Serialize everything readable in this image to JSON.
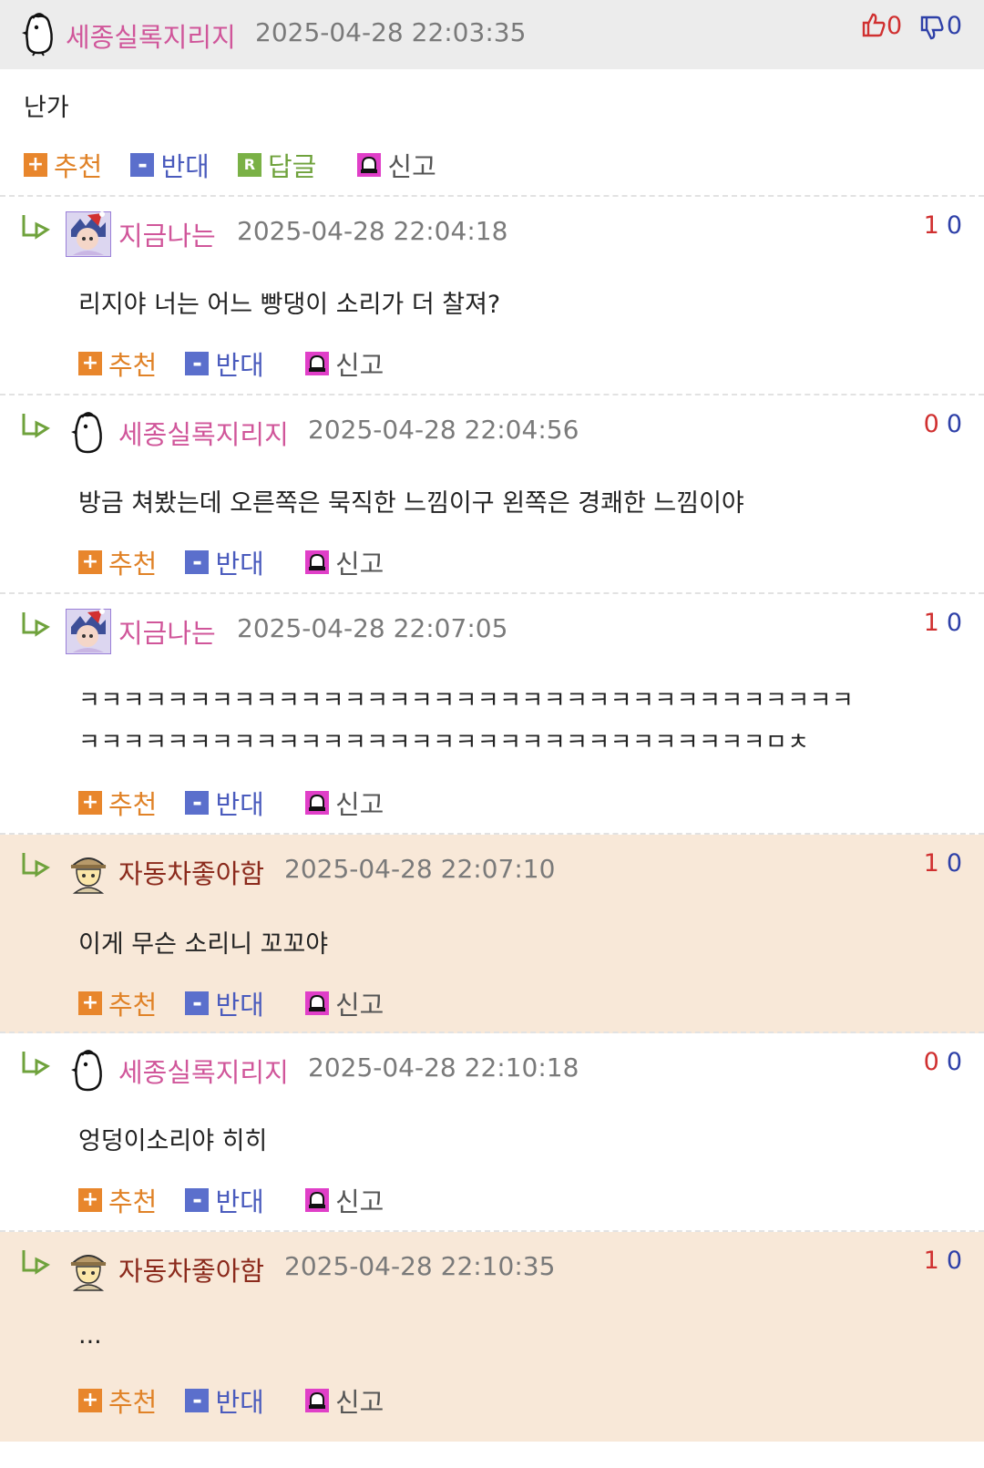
{
  "top": {
    "nick": "세종실록지리지",
    "date": "2025-04-28 22:03:35",
    "up": "0",
    "down": "0",
    "text": "난가",
    "actions": {
      "recommend": "추천",
      "oppose": "반대",
      "reply": "답글",
      "report": "신고"
    }
  },
  "replies": [
    {
      "nick": "지금나는",
      "date": "2025-04-28 22:04:18",
      "up": "1",
      "down": "0",
      "line1": "리지야 너는 어느 빵댕이 소리가 더 찰져?",
      "line2": ""
    },
    {
      "nick": "세종실록지리지",
      "date": "2025-04-28 22:04:56",
      "up": "0",
      "down": "0",
      "line1": "방금 쳐봤는데 오른쪽은 묵직한 느낌이구 왼쪽은 경쾌한 느낌이야",
      "line2": ""
    },
    {
      "nick": "지금나는",
      "date": "2025-04-28 22:07:05",
      "up": "1",
      "down": "0",
      "line1": "ㅋㅋㅋㅋㅋㅋㅋㅋㅋㅋㅋㅋㅋㅋㅋㅋㅋㅋㅋㅋㅋㅋㅋㅋㅋㅋㅋㅋㅋㅋㅋㅋㅋㅋㅋ",
      "line2": "ㅋㅋㅋㅋㅋㅋㅋㅋㅋㅋㅋㅋㅋㅋㅋㅋㅋㅋㅋㅋㅋㅋㅋㅋㅋㅋㅋㅋㅋㅋㅋㅁㅊ"
    },
    {
      "nick": "자동차좋아함",
      "date": "2025-04-28 22:07:10",
      "up": "1",
      "down": "0",
      "line1": "이게 무슨 소리니 꼬꼬야",
      "line2": ""
    },
    {
      "nick": "세종실록지리지",
      "date": "2025-04-28 22:10:18",
      "up": "0",
      "down": "0",
      "line1": "엉덩이소리야 히히",
      "line2": ""
    },
    {
      "nick": "자동차좋아함",
      "date": "2025-04-28 22:10:35",
      "up": "1",
      "down": "0",
      "line1": "...",
      "line2": ""
    }
  ],
  "reply_actions": {
    "recommend": "추천",
    "oppose": "반대",
    "report": "신고"
  },
  "icons": {
    "recommend": "plus-icon",
    "oppose": "minus-icon",
    "reply": "reply-r-icon",
    "report": "siren-icon",
    "thumbs_up": "thumbs-up-icon",
    "thumbs_down": "thumbs-down-icon",
    "reply_arrow": "reply-arrow-icon"
  },
  "colors": {
    "nick": "#d0569a",
    "nick_highlight": "#8b2a1c",
    "highlight_bg": "#f8e8d8",
    "up": "#d03030",
    "down": "#2e40a8"
  }
}
